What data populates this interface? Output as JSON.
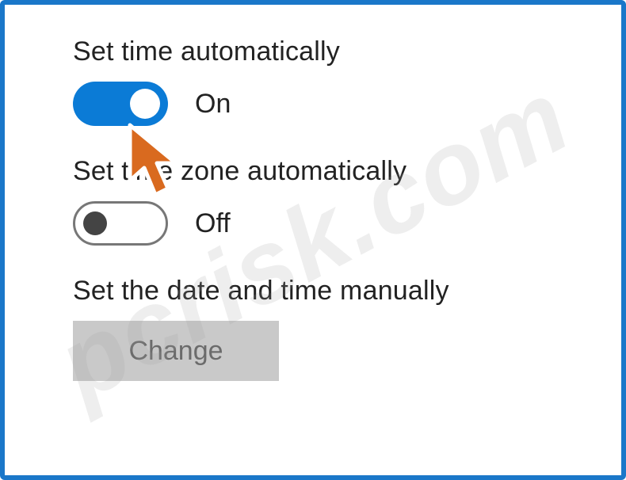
{
  "settings": {
    "set_time_auto": {
      "label": "Set time automatically",
      "state_text": "On",
      "on": true
    },
    "set_tz_auto": {
      "label": "Set time zone automatically",
      "state_text": "Off",
      "on": false
    },
    "manual": {
      "label": "Set the date and time manually",
      "button": "Change"
    }
  },
  "watermark": "pcrisk.com"
}
